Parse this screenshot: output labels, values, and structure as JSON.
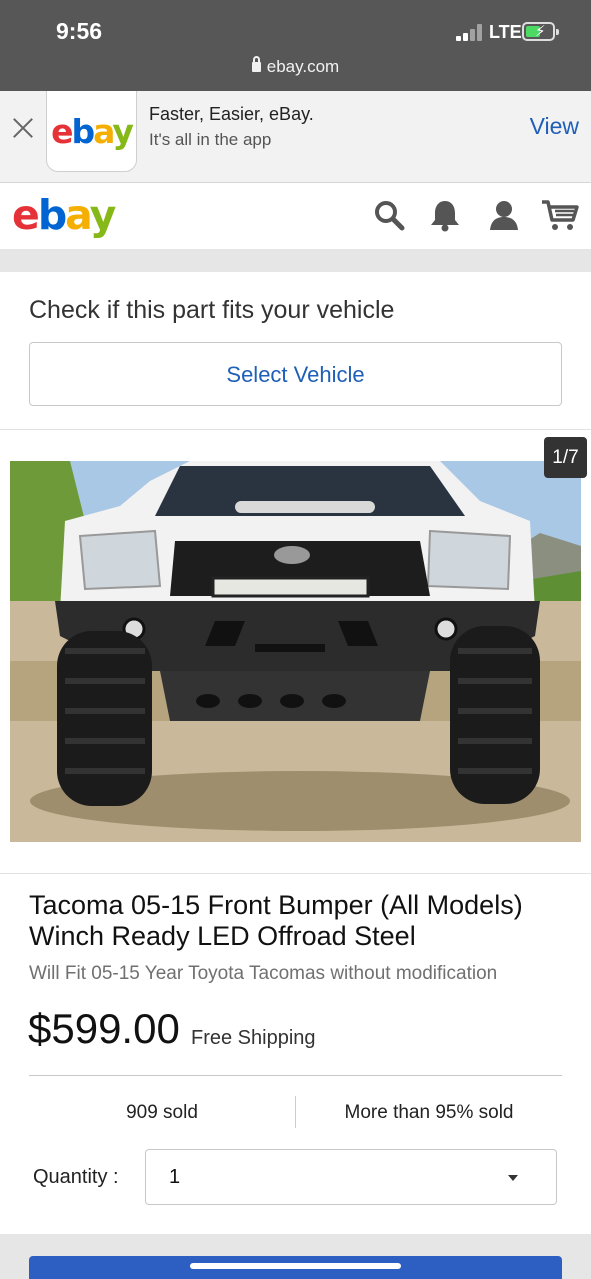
{
  "status_bar": {
    "time": "9:56",
    "network": "LTE",
    "url": "ebay.com"
  },
  "app_banner": {
    "title": "Faster, Easier, eBay.",
    "subtitle": "It's all in the app",
    "view_label": "View"
  },
  "brand": {
    "logo": [
      "e",
      "b",
      "a",
      "y"
    ],
    "colors": {
      "e": "#e53238",
      "b": "#0064d2",
      "a": "#f5af02",
      "y": "#86b817"
    }
  },
  "header": {
    "icons": [
      "search-icon",
      "bell-icon",
      "user-icon",
      "cart-icon"
    ]
  },
  "fitment": {
    "question": "Check if this part fits your vehicle",
    "button_label": "Select Vehicle"
  },
  "gallery": {
    "counter": "1/7"
  },
  "listing": {
    "title": "Tacoma 05-15 Front Bumper (All Models) Winch Ready LED Offroad Steel",
    "subtitle": "Will Fit 05-15 Year Toyota Tacomas without modification",
    "price": "$599.00",
    "shipping": "Free Shipping",
    "sold": "909 sold",
    "sold_rate": "More than 95% sold",
    "quantity_label": "Quantity :",
    "quantity_value": "1"
  },
  "accent_color": "#2d5fc3"
}
